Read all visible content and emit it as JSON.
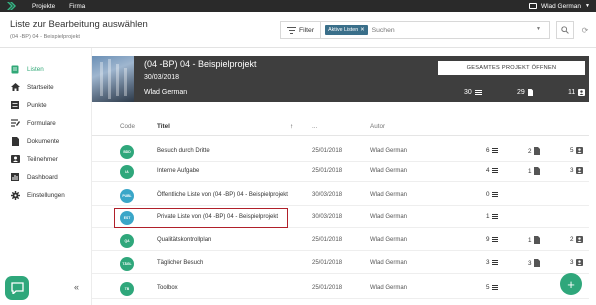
{
  "topbar": {
    "nav": [
      "Projekte",
      "Firma"
    ],
    "user_name": "Wlad German"
  },
  "header": {
    "title": "Liste zur Bearbeitung auswählen",
    "breadcrumb": "(04 -BP) 04 - Beispielprojekt",
    "filter_label": "Filter",
    "active_chip": "Aktive Listen",
    "search_placeholder": "Suchen"
  },
  "sidebar": {
    "items": [
      {
        "label": "Listen",
        "icon": "list-icon",
        "active": true
      },
      {
        "label": "Startseite",
        "icon": "home-icon",
        "active": false
      },
      {
        "label": "Punkte",
        "icon": "points-icon",
        "active": false
      },
      {
        "label": "Formulare",
        "icon": "forms-icon",
        "active": false
      },
      {
        "label": "Dokumente",
        "icon": "documents-icon",
        "active": false
      },
      {
        "label": "Teilnehmer",
        "icon": "participants-icon",
        "active": false
      },
      {
        "label": "Dashboard",
        "icon": "dashboard-icon",
        "active": false
      },
      {
        "label": "Einstellungen",
        "icon": "gear-icon",
        "active": false
      }
    ]
  },
  "project": {
    "title": "(04 -BP) 04 - Beispielprojekt",
    "date": "30/03/2018",
    "user": "Wlad German",
    "open_button": "GESAMTES PROJEKT ÖFFNEN",
    "stats": {
      "lists": "30",
      "documents": "29",
      "participants": "11"
    }
  },
  "table": {
    "headers": {
      "code": "Code",
      "title": "Titel",
      "date": "...",
      "author": "Autor"
    },
    "rows": [
      {
        "code": "BDD",
        "title": "Besuch durch Dritte",
        "date": "25/01/2018",
        "author": "Wlad German",
        "c1": "6",
        "c2": "2",
        "c3": "5",
        "blue": false
      },
      {
        "code": "IA",
        "title": "Interne Aufgabe",
        "date": "25/01/2018",
        "author": "Wlad German",
        "c1": "4",
        "c2": "1",
        "c3": "3",
        "blue": false
      },
      {
        "code": "PUBL",
        "title": "Öffentliche Liste von (04 -BP) 04 - Beispielprojekt",
        "date": "30/03/2018",
        "author": "Wlad German",
        "c1": "0",
        "c2": "",
        "c3": "",
        "blue": true
      },
      {
        "code": "EST",
        "title": "Private Liste von (04 -BP) 04 - Beispielprojekt",
        "date": "30/03/2018",
        "author": "Wlad German",
        "c1": "1",
        "c2": "",
        "c3": "",
        "blue": true
      },
      {
        "code": "QA",
        "title": "Qualitätskontrollplan",
        "date": "25/01/2018",
        "author": "Wlad German",
        "c1": "9",
        "c2": "1",
        "c3": "2",
        "blue": false
      },
      {
        "code": "TÄGL",
        "title": "Täglicher Besuch",
        "date": "25/01/2018",
        "author": "Wlad German",
        "c1": "3",
        "c2": "3",
        "c3": "3",
        "blue": false
      },
      {
        "code": "TB",
        "title": "Toolbox",
        "date": "25/01/2018",
        "author": "Wlad German",
        "c1": "5",
        "c2": "",
        "c3": "",
        "blue": false
      }
    ]
  },
  "colors": {
    "brand_green": "#2fa77b",
    "topbar": "#2a2a2a",
    "banner": "#3e3e3e",
    "highlight": "#b0202a"
  }
}
